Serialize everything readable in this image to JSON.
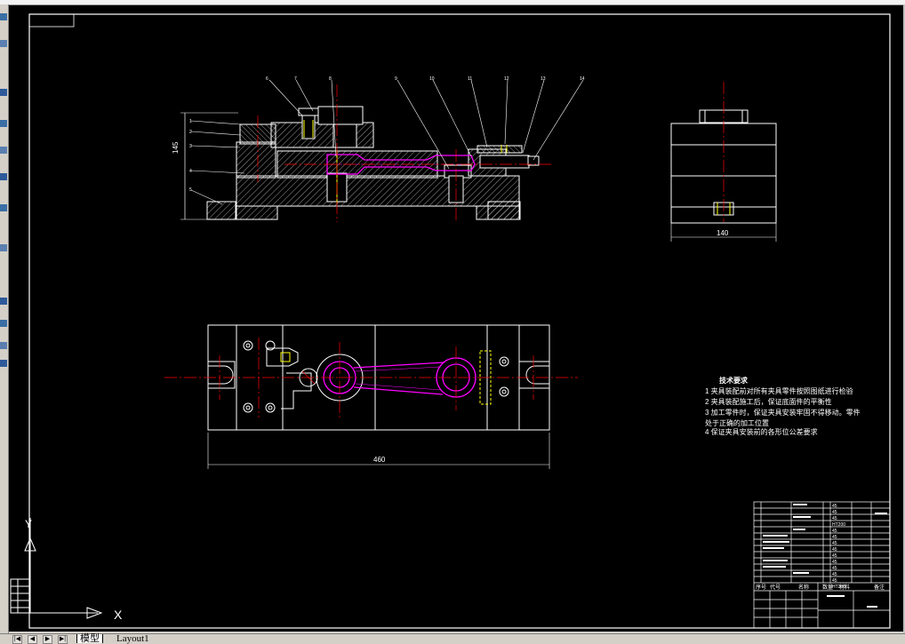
{
  "drawing": {
    "dimensions": {
      "height_front": "145",
      "width_side": "140",
      "width_top": "460"
    },
    "part_balloons": [
      "1",
      "2",
      "3",
      "4",
      "5",
      "6",
      "7",
      "8",
      "9",
      "10",
      "11",
      "12",
      "13",
      "14"
    ],
    "technical_requirements": {
      "title": "技术要求",
      "items": [
        "1  夹具装配前对所有夹具零件按照图纸进行检验",
        "2  夹具装配施工后，保证底面件的平衡性",
        "3  加工零件时，保证夹具安装牢固不得移动。零件",
        "    处于正确的加工位置",
        "4  保证夹具安装前的各形位公差要求"
      ]
    },
    "title_block": {
      "header_labels": [
        "序号",
        "代号",
        "名称",
        "数量",
        "材料",
        "备注"
      ],
      "materials": [
        "45",
        "45",
        "45",
        "HT200",
        "45",
        "45",
        "45",
        "45",
        "45",
        "45",
        "45",
        "45",
        "45",
        "HT200"
      ]
    },
    "ucs_icon": {
      "x_label": "X",
      "y_label": "Y"
    }
  },
  "tabs": {
    "model": "模型",
    "layout1": "Layout1"
  },
  "nav_buttons": [
    "|◀",
    "◀",
    "▶",
    "▶|"
  ],
  "colors": {
    "canvas_bg": "#000000",
    "line": "#ffffff",
    "centerline": "#ff0000",
    "workpiece": "#ff00ff",
    "hatch": "#ffffff",
    "chrome": "#d4d0c8"
  }
}
